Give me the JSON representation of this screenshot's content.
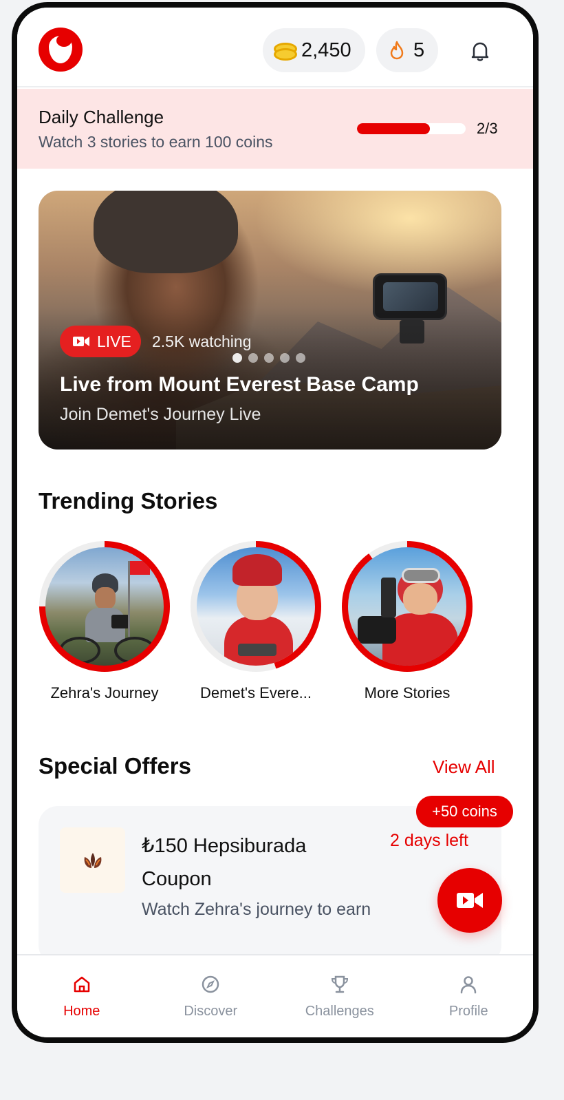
{
  "header": {
    "coins": "2,450",
    "streak": "5",
    "icons": [
      "vodafone-logo",
      "coin-icon",
      "flame-icon",
      "bell-icon"
    ]
  },
  "daily_challenge": {
    "title": "Daily Challenge",
    "description": "Watch 3 stories to earn 100 coins",
    "progress_text": "2/3",
    "progress_fraction": 0.67
  },
  "hero": {
    "live_label": "LIVE",
    "watching": "2.5K watching",
    "title": "Live from Mount Everest Base Camp",
    "subtitle": "Join Demet's Journey Live",
    "carousel_pages": 5,
    "active_page": 1
  },
  "trending": {
    "title": "Trending Stories",
    "stories": [
      {
        "label": "Zehra's Journey",
        "progress": 0.75
      },
      {
        "label": "Demet's Evere...",
        "progress": 0.45
      },
      {
        "label": "More Stories",
        "progress": 0.9
      }
    ]
  },
  "offers": {
    "title": "Special Offers",
    "view_all": "View All",
    "coins_badge": "+50 coins",
    "items": [
      {
        "title": "₺150 Hepsiburada Coupon",
        "subtitle": "Watch Zehra's journey to earn",
        "expires": "2 days left"
      }
    ]
  },
  "nav": {
    "items": [
      {
        "label": "Home",
        "icon": "home-icon"
      },
      {
        "label": "Discover",
        "icon": "compass-icon"
      },
      {
        "label": "Challenges",
        "icon": "trophy-icon"
      },
      {
        "label": "Profile",
        "icon": "user-icon"
      }
    ],
    "active": "Home"
  },
  "colors": {
    "brand": "#e60000",
    "challenge_bg": "#fde5e5",
    "muted_text": "#4a5363",
    "inactive_nav": "#8a929e"
  }
}
